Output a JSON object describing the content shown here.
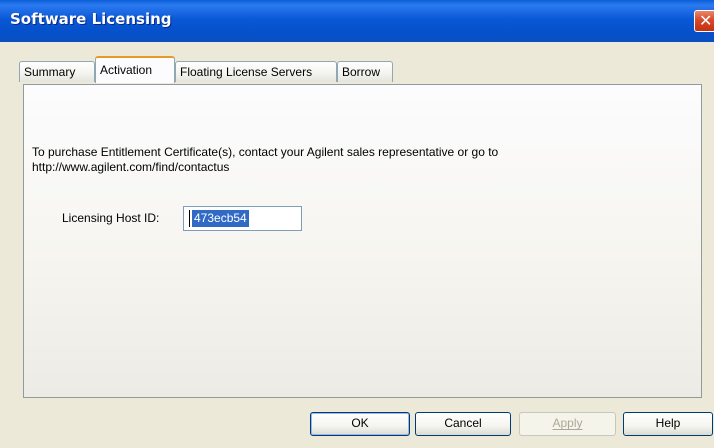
{
  "window": {
    "title": "Software Licensing"
  },
  "tabs": [
    {
      "label": "Summary",
      "active": false
    },
    {
      "label": "Activation",
      "active": true
    },
    {
      "label": "Floating License Servers",
      "active": false
    },
    {
      "label": "Borrow",
      "active": false
    }
  ],
  "activation": {
    "description_line1": "To purchase Entitlement Certificate(s), contact your Agilent sales representative or go to",
    "description_line2": "http://www.agilent.com/find/contactus",
    "host_label": "Licensing Host ID:",
    "host_value": "473ecb54"
  },
  "buttons": {
    "ok": "OK",
    "cancel": "Cancel",
    "apply": "Apply",
    "help": "Help"
  },
  "colors": {
    "titlebar": "#0a58d6",
    "window_bg": "#ece9d8",
    "selection": "#316ac5",
    "active_tab_accent": "#e69b29",
    "close_button": "#d8482a"
  },
  "icons": {
    "close": "close-icon"
  }
}
